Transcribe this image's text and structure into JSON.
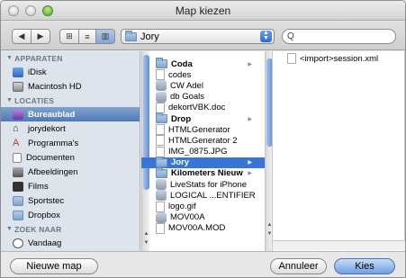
{
  "window": {
    "title": "Map kiezen"
  },
  "toolbar": {
    "back_glyph": "◀",
    "forward_glyph": "▶",
    "view_icon_glyph": "⊞",
    "view_list_glyph": "≡",
    "view_column_glyph": "▥",
    "path": "Jory",
    "search_placeholder": "",
    "search_glyph": "Q"
  },
  "sidebar": {
    "sections": [
      {
        "label": "APPARATEN",
        "items": [
          {
            "label": "iDisk",
            "icon": "idisk-icon",
            "selected": false
          },
          {
            "label": "Macintosh HD",
            "icon": "hard-disk-icon",
            "selected": false
          }
        ]
      },
      {
        "label": "LOCATIES",
        "items": [
          {
            "label": "Bureaublad",
            "icon": "desktop-icon",
            "selected": true
          },
          {
            "label": "jorydekort",
            "icon": "home-icon",
            "selected": false
          },
          {
            "label": "Programma's",
            "icon": "applications-icon",
            "selected": false
          },
          {
            "label": "Documenten",
            "icon": "documents-icon",
            "selected": false
          },
          {
            "label": "Afbeeldingen",
            "icon": "pictures-icon",
            "selected": false
          },
          {
            "label": "Films",
            "icon": "movies-icon",
            "selected": false
          },
          {
            "label": "Sportstec",
            "icon": "folder-icon",
            "selected": false
          },
          {
            "label": "Dropbox",
            "icon": "folder-icon",
            "selected": false
          }
        ]
      },
      {
        "label": "ZOEK NAAR",
        "items": [
          {
            "label": "Vandaag",
            "icon": "clock-icon",
            "selected": false
          }
        ]
      }
    ]
  },
  "column1": {
    "items": [
      {
        "label": "Coda",
        "kind": "folder",
        "bold": true,
        "has_children": true,
        "selected": false
      },
      {
        "label": "codes",
        "kind": "doc",
        "bold": false,
        "has_children": false,
        "selected": false
      },
      {
        "label": "CW Adel",
        "kind": "app",
        "bold": false,
        "has_children": false,
        "selected": false
      },
      {
        "label": "db Goals",
        "kind": "app",
        "bold": false,
        "has_children": false,
        "selected": false
      },
      {
        "label": "dekortVBK.doc",
        "kind": "doc",
        "bold": false,
        "has_children": false,
        "selected": false
      },
      {
        "label": "Drop",
        "kind": "folder",
        "bold": true,
        "has_children": true,
        "selected": false
      },
      {
        "label": "HTMLGenerator",
        "kind": "doc",
        "bold": false,
        "has_children": false,
        "selected": false
      },
      {
        "label": "HTMLGenerator 2",
        "kind": "doc",
        "bold": false,
        "has_children": false,
        "selected": false
      },
      {
        "label": "IMG_0875.JPG",
        "kind": "doc",
        "bold": false,
        "has_children": false,
        "selected": false
      },
      {
        "label": "Jory",
        "kind": "folder",
        "bold": true,
        "has_children": true,
        "selected": true
      },
      {
        "label": "Kilometers Nieuw",
        "kind": "folder",
        "bold": true,
        "has_children": true,
        "selected": false
      },
      {
        "label": "LiveStats for iPhone",
        "kind": "app",
        "bold": false,
        "has_children": false,
        "selected": false
      },
      {
        "label": "LOGICAL ...ENTIFIER",
        "kind": "app",
        "bold": false,
        "has_children": false,
        "selected": false
      },
      {
        "label": "logo.gif",
        "kind": "doc",
        "bold": false,
        "has_children": false,
        "selected": false
      },
      {
        "label": "MOV00A",
        "kind": "app",
        "bold": false,
        "has_children": false,
        "selected": false
      },
      {
        "label": "MOV00A.MOD",
        "kind": "doc",
        "bold": false,
        "has_children": false,
        "selected": false
      }
    ],
    "chevron_glyph": "▶"
  },
  "column2": {
    "items": [
      {
        "label": "<import>session.xml",
        "kind": "doc"
      }
    ]
  },
  "buttons": {
    "new_folder": "Nieuwe map",
    "cancel": "Annuleer",
    "choose": "Kies"
  }
}
